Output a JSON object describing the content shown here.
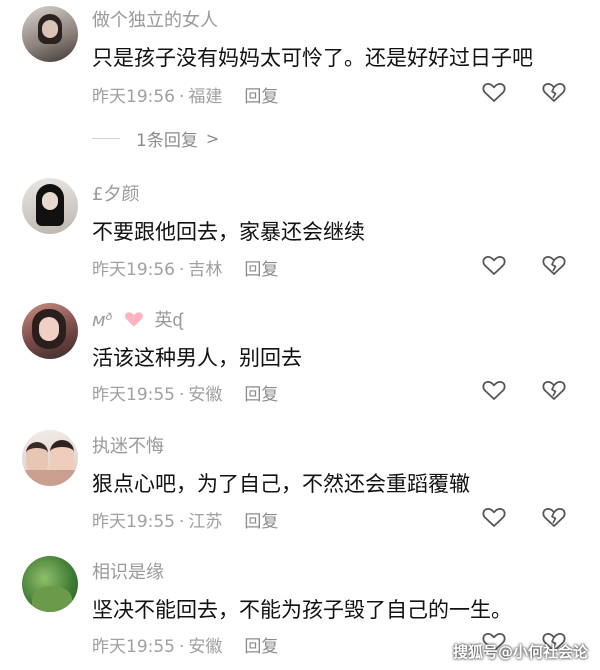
{
  "comments": [
    {
      "username": "做个独立的女人",
      "content": "只是孩子没有妈妈太可怜了。还是好好过日子吧",
      "time": "昨天19:56",
      "location": "福建",
      "reply_label": "回复",
      "replies_toggle": "1条回复"
    },
    {
      "username": "£夕颜",
      "content": "不要跟他回去，家暴还会继续",
      "time": "昨天19:56",
      "location": "吉林",
      "reply_label": "回复"
    },
    {
      "username": "英",
      "username_prefix": "ᴍᶞ",
      "username_suffix": "ᶑ",
      "content": "活该这种男人，别回去",
      "time": "昨天19:55",
      "location": "安徽",
      "reply_label": "回复"
    },
    {
      "username": "执迷不悔",
      "content": "狠点心吧，为了自己，不然还会重蹈覆辙",
      "time": "昨天19:55",
      "location": "江苏",
      "reply_label": "回复"
    },
    {
      "username": "相识是缘",
      "content": "坚决不能回去，不能为孩子毁了自己的一生。",
      "time": "昨天19:55",
      "location": "安徽",
      "reply_label": "回复"
    }
  ],
  "icons": {
    "like": "heart-outline-icon",
    "dislike": "broken-heart-outline-icon",
    "expand": "chevron-right-icon",
    "name_decoration": "pink-heart-icon"
  },
  "colors": {
    "text": "#111111",
    "muted": "#9a9a9a",
    "heart": "#ffb3c0"
  },
  "watermark": "搜狐号@小何社会论"
}
